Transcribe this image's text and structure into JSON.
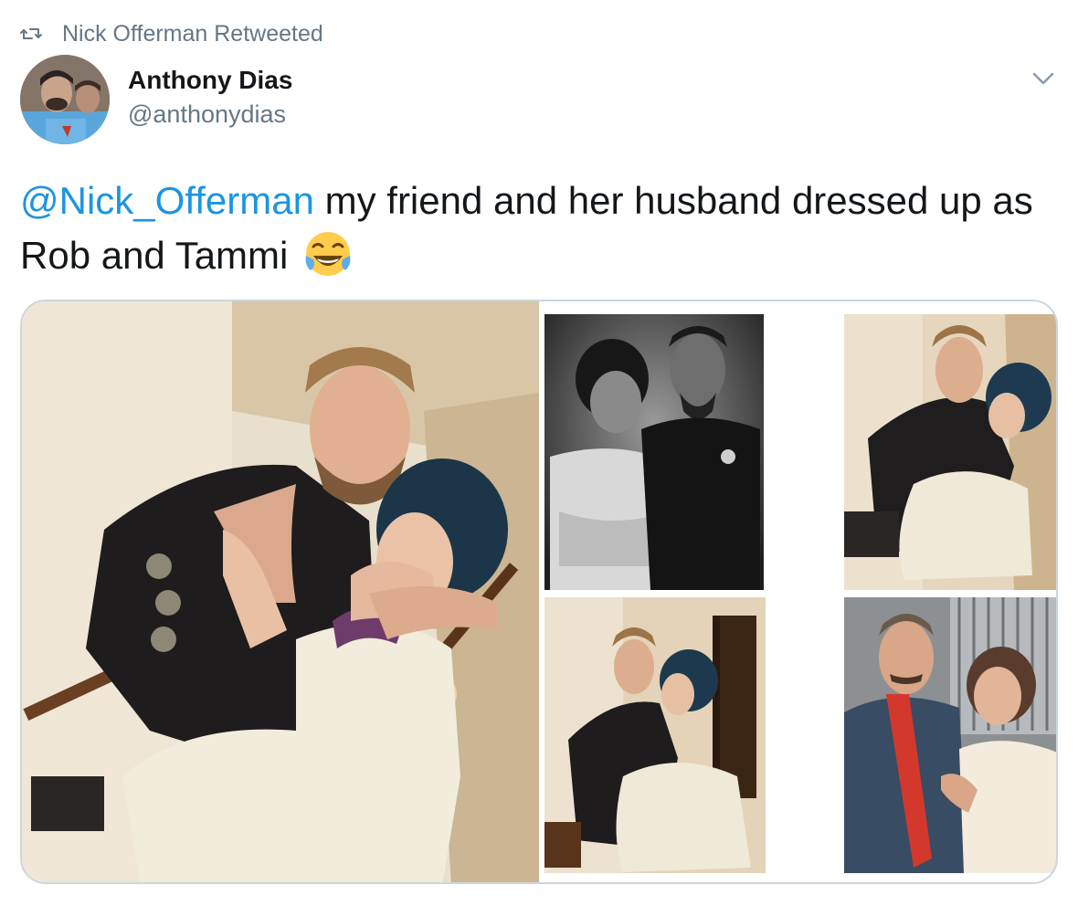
{
  "retweet_context": {
    "label": "Nick Offerman Retweeted",
    "icon": "retweet-icon"
  },
  "author": {
    "display_name": "Anthony Dias",
    "handle": "@anthonydias",
    "avatar_icon": "avatar"
  },
  "tweet": {
    "mention": "@Nick_Offerman",
    "text": " my friend and her husband dressed up as Rob and Tammi",
    "emoji": "face-with-tears-of-joy-icon"
  },
  "media": {
    "count": 5,
    "photos": [
      "photo-couple-stairs-large",
      "photo-tintype-portrait",
      "photo-couple-stairs-small",
      "photo-couple-stairs-kiss",
      "photo-nick-and-megan"
    ]
  },
  "colors": {
    "link": "#1b95e0",
    "secondary_text": "#657786",
    "primary_text": "#14171a",
    "border": "#ccd6dd"
  }
}
